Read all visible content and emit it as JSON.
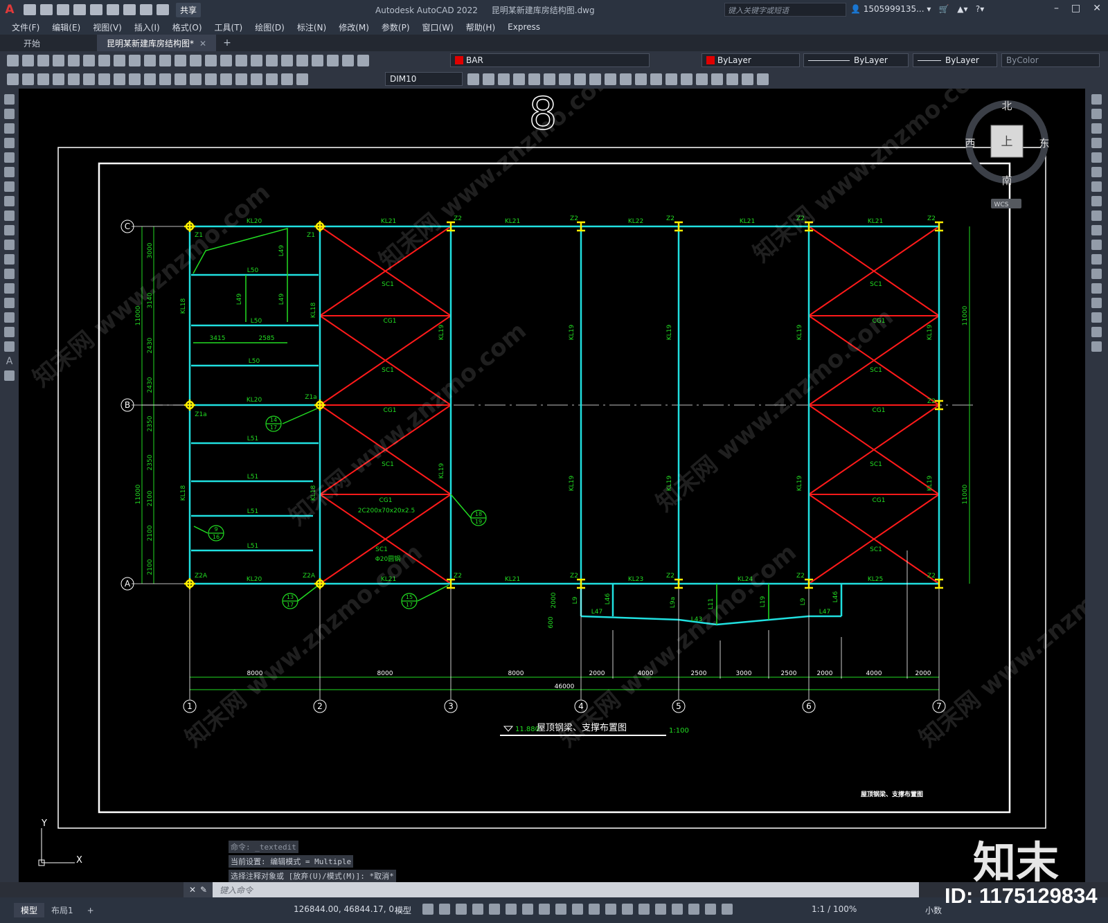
{
  "app": {
    "logo_letter": "A",
    "title": "Autodesk AutoCAD 2022",
    "filename": "昆明某新建库房结构图.dwg",
    "share_label": "共享",
    "search_placeholder": "键入关键字或短语",
    "user": "1505999135...",
    "window_controls": [
      "–",
      "□",
      "✕"
    ]
  },
  "menu": [
    "文件(F)",
    "编辑(E)",
    "视图(V)",
    "插入(I)",
    "格式(O)",
    "工具(T)",
    "绘图(D)",
    "标注(N)",
    "修改(M)",
    "参数(P)",
    "窗口(W)",
    "帮助(H)",
    "Express"
  ],
  "tabs": [
    {
      "label": "开始",
      "active": false
    },
    {
      "label": "昆明某新建库房结构图*",
      "active": true,
      "close": "✕"
    }
  ],
  "tab_add": "+",
  "toolbar1": {
    "layer": "BAR",
    "color": "ByLayer",
    "linetype": "ByLayer",
    "lineweight": "ByLayer",
    "plotstyle": "ByColor",
    "layer_color": "#e00000"
  },
  "toolbar2": {
    "dimstyle": "DIM10"
  },
  "viewcube": {
    "north": "北",
    "south": "南",
    "east": "东",
    "west": "西",
    "top": "上",
    "wcs": "WCS"
  },
  "command_history": [
    "命令: _textedit",
    "当前设置: 编辑模式 = Multiple",
    "选择注释对象或 [放弃(U)/模式(M)]: *取消*"
  ],
  "command_prompt": "键入命令",
  "layout_tabs": [
    "模型",
    "布局1"
  ],
  "layout_add": "+",
  "status": {
    "coords": "126844.00, 46844.17, 0....",
    "model": "模型",
    "scale": "1:1 / 100%",
    "units": "小数"
  },
  "watermark": {
    "logo": "知末",
    "id": "ID: 1175129834",
    "diagonal": "知末网 www.znzmo.com"
  },
  "drawing": {
    "sheet_number": "8",
    "plan_title": "屋顶钢梁、支撑布置图",
    "plan_elev": "11.880",
    "plan_scale": "1:100",
    "titleblock_label": "屋顶钢梁、支撑布置图",
    "grid_rows": [
      "C",
      "B",
      "A"
    ],
    "grid_cols": [
      "1",
      "2",
      "3",
      "4",
      "5",
      "6",
      "7"
    ],
    "bottom_dims": [
      "8000",
      "8000",
      "8000",
      "2000",
      "4000",
      "2500",
      "3000",
      "2500",
      "2000",
      "4000",
      "2000"
    ],
    "total_dim": "46000",
    "left_dims": [
      "3000",
      "3140",
      "2430",
      "2430",
      "2350",
      "2350",
      "2100",
      "2100",
      "2100"
    ],
    "left_totals": [
      "11000",
      "11000"
    ],
    "right_totals": [
      "11000",
      "11000"
    ],
    "top_beams": [
      "KL20",
      "KL21",
      "KL21",
      "KL22",
      "KL21",
      "KL21"
    ],
    "mid_beams": [
      "KL20"
    ],
    "bot_beams": [
      "KL20",
      "KL21",
      "KL21",
      "KL23",
      "KL24",
      "KL25"
    ],
    "columns": [
      "Z1",
      "Z1",
      "Z2",
      "Z2",
      "Z2",
      "Z2",
      "Z2",
      "Z1a",
      "Z1a",
      "Z2",
      "Z2A",
      "Z2A",
      "Z2",
      "Z2",
      "Z2",
      "Z2",
      "Z2"
    ],
    "vertical_beams": [
      "KL18",
      "KL18",
      "KL19",
      "KL19",
      "KL19",
      "KL19",
      "KL19",
      "KL18",
      "KL18",
      "KL19",
      "KL19",
      "KL19",
      "KL19",
      "KL19"
    ],
    "secondary_beams": [
      "L50",
      "L50",
      "L50",
      "L51",
      "L51",
      "L51",
      "L51",
      "L49",
      "L49",
      "L49"
    ],
    "bracing": [
      "SC1",
      "CG1",
      "SC1",
      "CG1",
      "SC1",
      "CG1",
      "SC1",
      "SC1",
      "CG1",
      "SC1",
      "CG1",
      "SC1",
      "CG1",
      "SC1"
    ],
    "cg_note": "2C200x70x20x2.5",
    "sc_note": "Φ20圆钢",
    "small_dims": [
      "3415",
      "2585",
      "2000",
      "600"
    ],
    "canopy_beams": [
      "L9",
      "L46",
      "L47",
      "L9a",
      "L43",
      "L11",
      "L19",
      "L9",
      "L47",
      "L46"
    ],
    "detail_refs": [
      [
        "14",
        "17"
      ],
      [
        "9",
        "16"
      ],
      [
        "18",
        "19"
      ],
      [
        "13",
        "17"
      ],
      [
        "15",
        "17"
      ]
    ]
  }
}
